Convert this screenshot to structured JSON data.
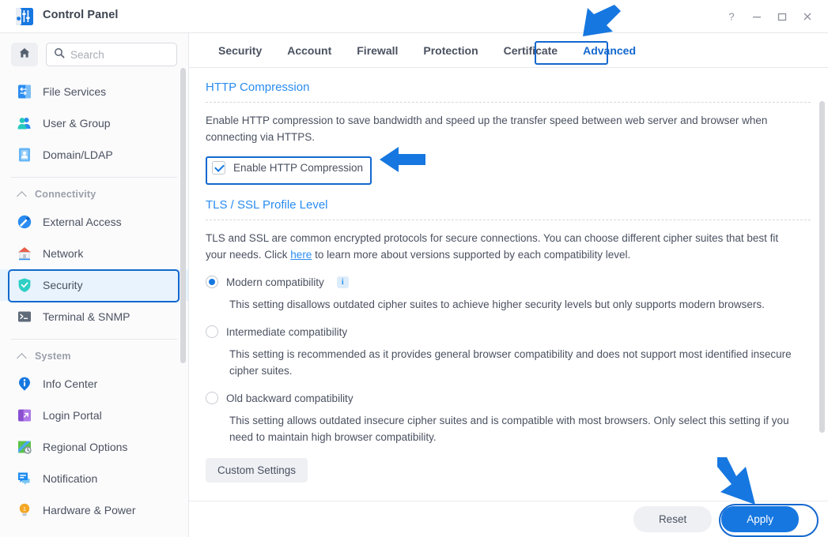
{
  "window": {
    "title": "Control Panel",
    "app_icon": "control-panel-icon",
    "controls": {
      "help": "?",
      "minimize": "minimize",
      "maximize": "maximize",
      "close": "close"
    }
  },
  "sidebar": {
    "home_icon": "home-icon",
    "search": {
      "icon": "search-icon",
      "placeholder": "Search",
      "value": ""
    },
    "items": [
      {
        "label": "File Services",
        "icon": "file-services-icon",
        "type": "item",
        "selected": false
      },
      {
        "label": "User & Group",
        "icon": "user-group-icon",
        "type": "item",
        "selected": false
      },
      {
        "label": "Domain/LDAP",
        "icon": "domain-ldap-icon",
        "type": "item",
        "selected": false
      },
      {
        "label": "Connectivity",
        "icon": "chevron-up-icon",
        "type": "group"
      },
      {
        "label": "External Access",
        "icon": "external-access-icon",
        "type": "item",
        "selected": false
      },
      {
        "label": "Network",
        "icon": "network-icon",
        "type": "item",
        "selected": false
      },
      {
        "label": "Security",
        "icon": "security-shield-icon",
        "type": "item",
        "selected": true
      },
      {
        "label": "Terminal & SNMP",
        "icon": "terminal-snmp-icon",
        "type": "item",
        "selected": false
      },
      {
        "label": "System",
        "icon": "chevron-up-icon",
        "type": "group"
      },
      {
        "label": "Info Center",
        "icon": "info-center-icon",
        "type": "item",
        "selected": false
      },
      {
        "label": "Login Portal",
        "icon": "login-portal-icon",
        "type": "item",
        "selected": false
      },
      {
        "label": "Regional Options",
        "icon": "regional-options-icon",
        "type": "item",
        "selected": false
      },
      {
        "label": "Notification",
        "icon": "notification-icon",
        "type": "item",
        "selected": false
      },
      {
        "label": "Hardware & Power",
        "icon": "hardware-power-icon",
        "type": "item",
        "selected": false
      }
    ]
  },
  "tabs": [
    {
      "label": "Security",
      "active": false
    },
    {
      "label": "Account",
      "active": false
    },
    {
      "label": "Firewall",
      "active": false
    },
    {
      "label": "Protection",
      "active": false
    },
    {
      "label": "Certificate",
      "active": false
    },
    {
      "label": "Advanced",
      "active": true
    }
  ],
  "http_compression": {
    "title": "HTTP Compression",
    "description": "Enable HTTP compression to save bandwidth and speed up the transfer speed between web server and browser when connecting via HTTPS.",
    "checkbox_label": "Enable HTTP Compression",
    "checked": true
  },
  "tls_ssl": {
    "title": "TLS / SSL Profile Level",
    "description_before_link": "TLS and SSL are common encrypted protocols for secure connections. You can choose different cipher suites that best fit your needs. Click ",
    "link_text": "here",
    "description_after_link": " to learn more about versions supported by each compatibility level.",
    "options": [
      {
        "label": "Modern compatibility",
        "selected": true,
        "has_info": true,
        "description": "This setting disallows outdated cipher suites to achieve higher security levels but only supports modern browsers."
      },
      {
        "label": "Intermediate compatibility",
        "selected": false,
        "has_info": false,
        "description": "This setting is recommended as it provides general browser compatibility and does not support most identified insecure cipher suites."
      },
      {
        "label": "Old backward compatibility",
        "selected": false,
        "has_info": false,
        "description": "This setting allows outdated insecure cipher suites and is compatible with most browsers. Only select this setting if you need to maintain high browser compatibility."
      }
    ],
    "custom_settings_label": "Custom Settings"
  },
  "footer": {
    "reset_label": "Reset",
    "apply_label": "Apply"
  },
  "annotations": {
    "accent_color": "#1368ce",
    "arrows": [
      {
        "name": "arrow-to-advanced-tab",
        "direction": "down-left"
      },
      {
        "name": "arrow-to-enable-http-compression",
        "direction": "left"
      },
      {
        "name": "arrow-to-apply-button",
        "direction": "down-right"
      }
    ],
    "highlight_boxes": [
      "advanced-tab-highlight",
      "security-sidebar-highlight",
      "enable-http-compression-highlight",
      "apply-button-highlight"
    ]
  }
}
